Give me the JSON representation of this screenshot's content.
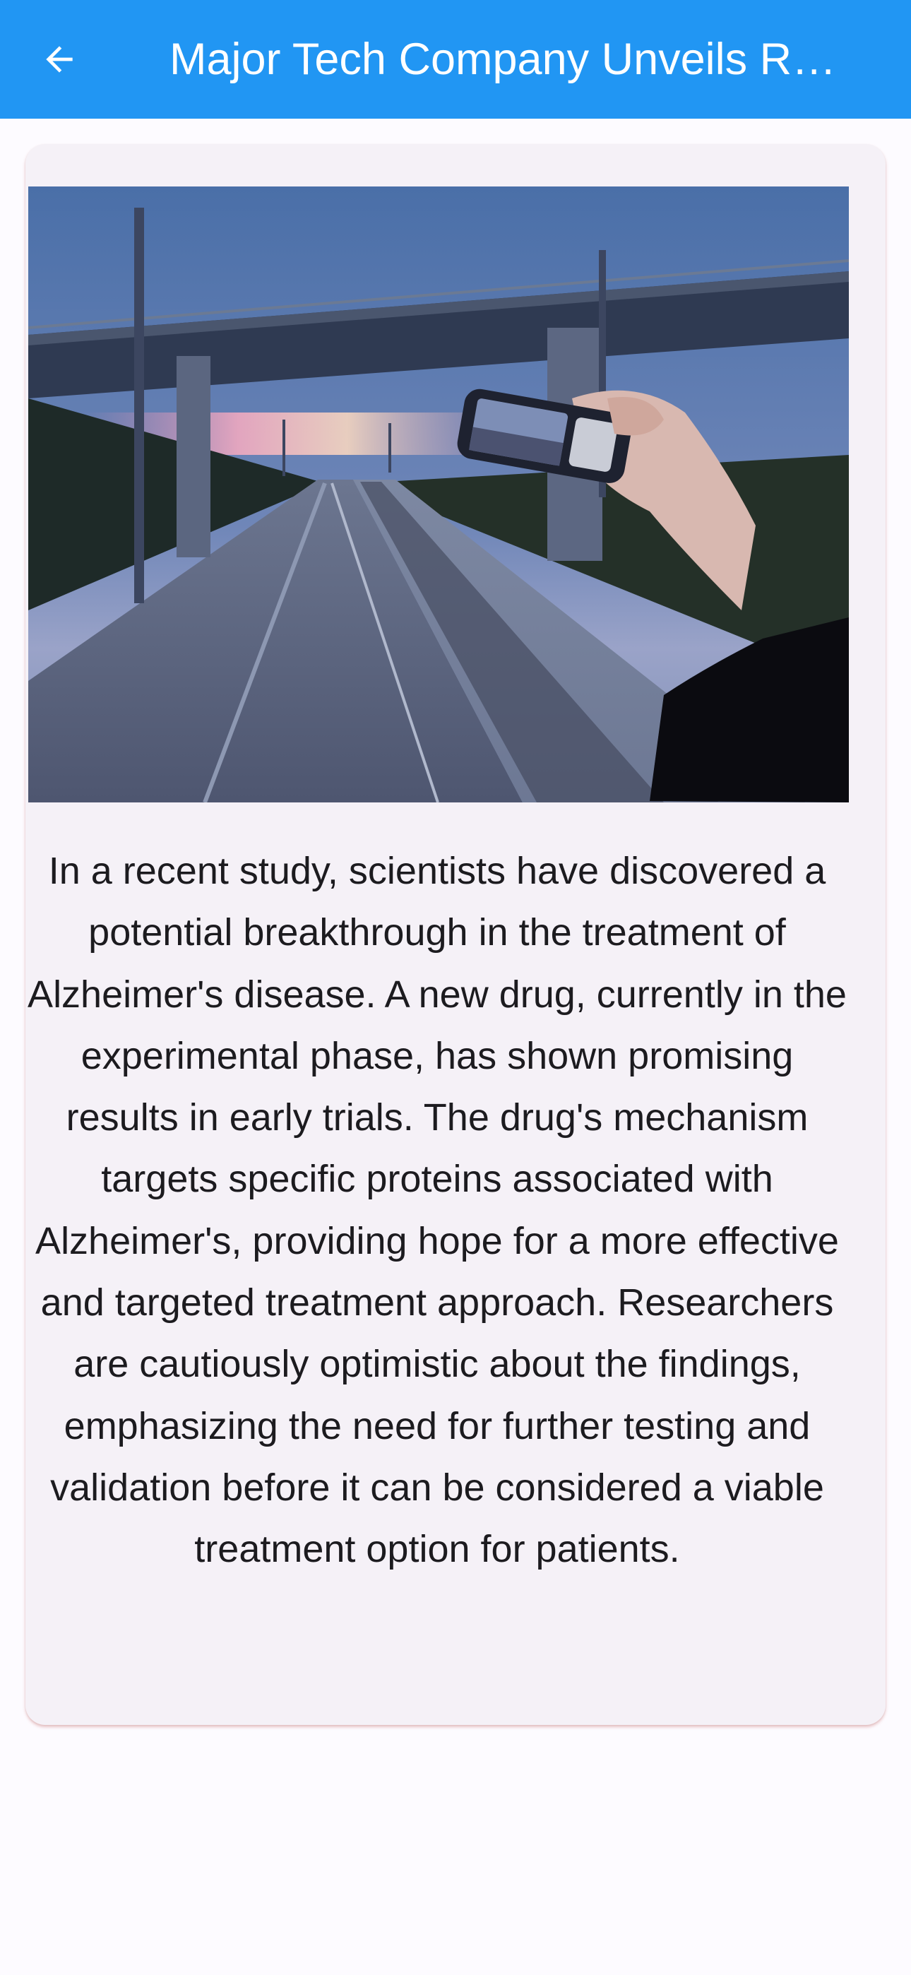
{
  "app_bar": {
    "title": "Major Tech Company Unveils R…",
    "back_icon": "arrow-left-icon",
    "color": "#2196f3"
  },
  "article": {
    "image": {
      "name": "article-image",
      "depicts": "hand-holding-phone-photographing-road-under-bridge"
    },
    "body": "In a recent study, scientists have discovered a potential breakthrough in the treatment of Alzheimer's disease. A new drug, currently in the experimental phase, has shown promising results in early trials. The drug's mechanism targets specific proteins associated with Alzheimer's, providing hope for a more effective and targeted treatment approach. Researchers are cautiously optimistic about the findings, emphasizing the need for further testing and validation before it can be considered a viable treatment option for patients."
  }
}
